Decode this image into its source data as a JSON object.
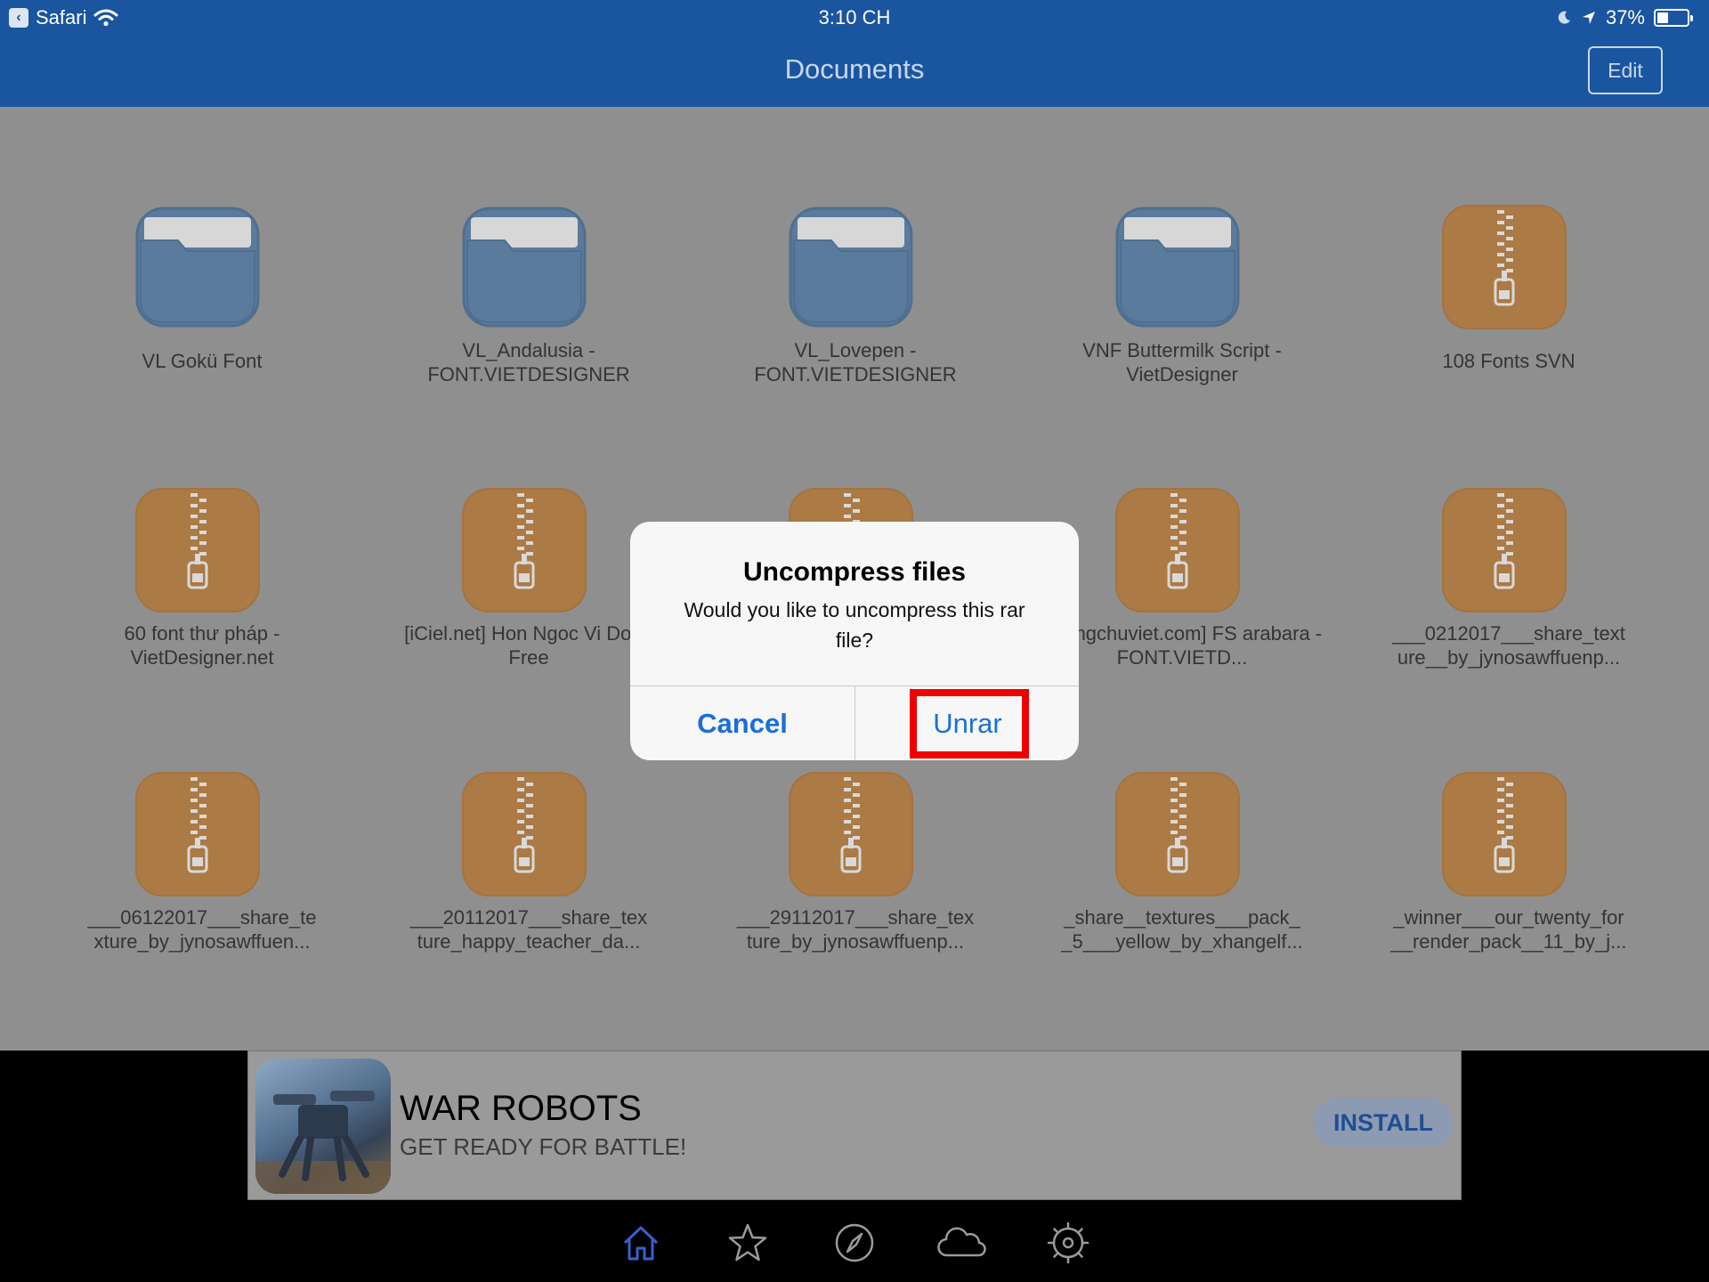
{
  "status_bar": {
    "back_app": "Safari",
    "time": "3:10 CH",
    "battery_text": "37%",
    "battery_level": 0.37
  },
  "nav": {
    "title": "Documents",
    "edit_label": "Edit"
  },
  "files": {
    "rows": [
      [
        {
          "type": "folder",
          "label": "VL Gokü Font"
        },
        {
          "type": "folder",
          "label": "VL_Andalusia - FONT.VIETDESIGNER"
        },
        {
          "type": "folder",
          "label": "VL_Lovepen - FONT.VIETDESIGNER"
        },
        {
          "type": "folder",
          "label": "VNF Buttermilk Script - VietDesigner"
        },
        {
          "type": "archive",
          "label": "108 Fonts SVN"
        }
      ],
      [
        {
          "type": "archive",
          "label": "60 font thư pháp - VietDesigner.net"
        },
        {
          "type": "archive",
          "label": "[iCiel.net] Hon Ngoc Vi Dong Free"
        },
        {
          "type": "archive",
          "label": ""
        },
        {
          "type": "archive",
          "label": "phongchuviet.com] FS arabara - FONT.VIETD..."
        },
        {
          "type": "archive",
          "label": "___0212017___share_text ure__by_jynosawffuenp..."
        }
      ],
      [
        {
          "type": "archive",
          "label": "___06122017___share_te xture_by_jynosawffuen..."
        },
        {
          "type": "archive",
          "label": "___20112017___share_tex ture_happy_teacher_da..."
        },
        {
          "type": "archive",
          "label": "___29112017___share_tex ture_by_jynosawffuenp..."
        },
        {
          "type": "archive",
          "label": "_share__textures___pack_ _5___yellow_by_xhangelf..."
        },
        {
          "type": "archive",
          "label": "_winner___our_twenty_for __render_pack__11_by_j..."
        }
      ]
    ]
  },
  "alert": {
    "title": "Uncompress files",
    "message": "Would you like to uncompress this rar file?",
    "cancel_label": "Cancel",
    "confirm_label": "Unrar"
  },
  "ad": {
    "title": "WAR ROBOTS",
    "subtitle": "GET READY FOR BATTLE!",
    "install_label": "INSTALL"
  },
  "tabbar": {
    "items": [
      {
        "icon": "home-icon",
        "active": true
      },
      {
        "icon": "star-icon",
        "active": false
      },
      {
        "icon": "compass-icon",
        "active": false
      },
      {
        "icon": "cloud-icon",
        "active": false
      },
      {
        "icon": "settings-icon",
        "active": false
      }
    ]
  },
  "colors": {
    "nav_bar": "#1a55a0",
    "folder": "#5b7b9d",
    "archive": "#ac7a44",
    "alert_button": "#1a6fd8",
    "highlight": "#ee0000",
    "tab_active": "#3b5fcf"
  }
}
